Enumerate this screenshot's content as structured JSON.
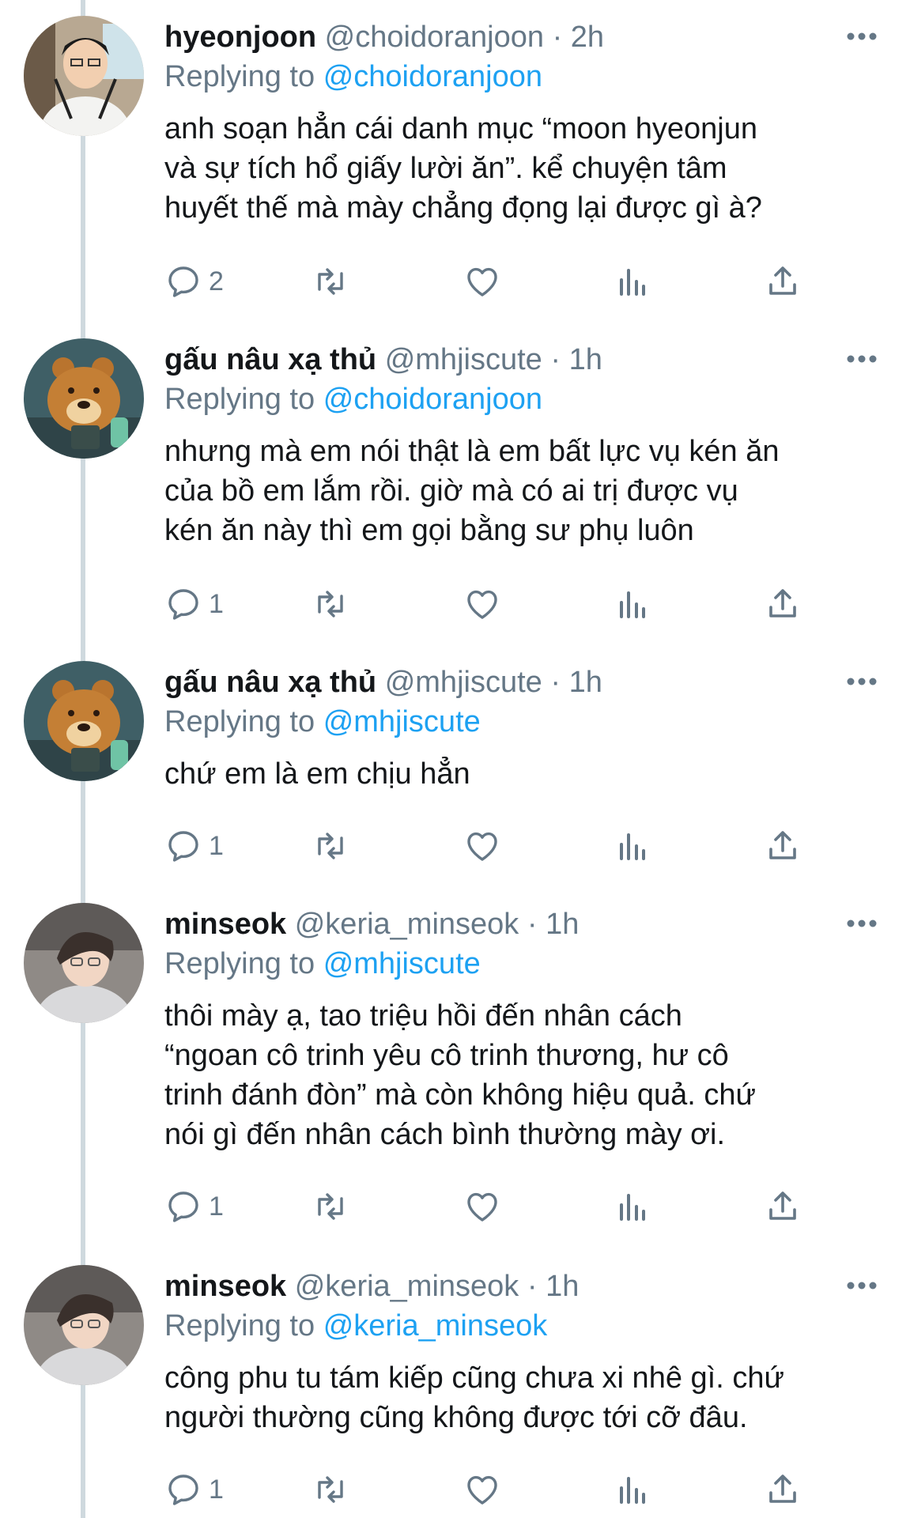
{
  "colors": {
    "link": "#1da1f2",
    "secondary_text": "#657786",
    "primary_text": "#14171a",
    "thread_line": "#cfd9de"
  },
  "icons": {
    "reply": "reply-icon",
    "retweet": "retweet-icon",
    "like": "heart-icon",
    "analytics": "analytics-icon",
    "share": "share-icon",
    "more": "more-icon"
  },
  "tweets": [
    {
      "name": "hyeonjoon",
      "handle": "@choidoranjoon",
      "time": "2h",
      "replying_label": "Replying to",
      "replying_to": "@choidoranjoon",
      "text": "anh soạn hẳn cái danh mục “moon hyeonjun\nvà sự tích hổ giấy lười ăn”. kể chuyện tâm\nhuyết thế mà mày chẳng đọng lại được gì à?",
      "reply_count": "2",
      "avatar": "person-photo"
    },
    {
      "name": "gấu nâu xạ thủ",
      "handle": "@mhjiscute",
      "time": "1h",
      "replying_label": "Replying to",
      "replying_to": "@choidoranjoon",
      "text": "nhưng mà em nói thật là em bất lực vụ kén ăn\ncủa bồ em lắm rồi. giờ mà có ai trị được vụ\nkén ăn này thì em gọi bằng sư phụ luôn",
      "reply_count": "1",
      "avatar": "bear-cartoon"
    },
    {
      "name": "gấu nâu xạ thủ",
      "handle": "@mhjiscute",
      "time": "1h",
      "replying_label": "Replying to",
      "replying_to": "@mhjiscute",
      "text": "chứ em là em chịu hẳn",
      "reply_count": "1",
      "avatar": "bear-cartoon"
    },
    {
      "name": "minseok",
      "handle": "@keria_minseok",
      "time": "1h",
      "replying_label": "Replying to",
      "replying_to": "@mhjiscute",
      "text": "thôi mày ạ, tao triệu hồi đến nhân cách\n“ngoan cô trinh yêu cô trinh thương, hư cô\ntrinh đánh đòn” mà còn không hiệu quả. chứ\nnói gì đến nhân cách bình thường mày ơi.",
      "reply_count": "1",
      "avatar": "person-photo"
    },
    {
      "name": "minseok",
      "handle": "@keria_minseok",
      "time": "1h",
      "replying_label": "Replying to",
      "replying_to": "@keria_minseok",
      "text": "công phu tu tám kiếp cũng chưa xi nhê gì. chứ\nngười thường cũng không được tới cỡ đâu.",
      "reply_count": "1",
      "avatar": "person-photo"
    }
  ]
}
